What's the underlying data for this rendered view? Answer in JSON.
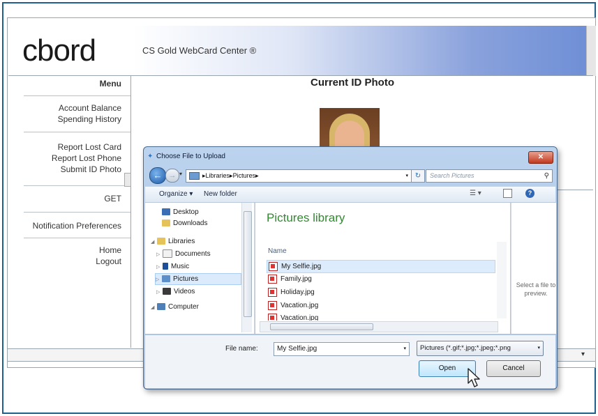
{
  "site": {
    "logo": "cbord",
    "banner_title": "CS Gold WebCard Center ®",
    "menu_title": "Menu",
    "menu_groups": [
      [
        "Account Balance",
        "Spending History"
      ],
      [
        "Report Lost Card",
        "Report Lost Phone",
        "Submit ID Photo"
      ],
      [
        "GET"
      ],
      [
        "Notification Preferences"
      ],
      [
        "Home",
        "Logout"
      ]
    ],
    "photo_title": "Current ID Photo"
  },
  "dialog": {
    "title": "Choose File to Upload",
    "close_symbol": "✕",
    "breadcrumb": [
      "Libraries",
      "Pictures"
    ],
    "search_placeholder": "Search Pictures",
    "toolbar": {
      "organize": "Organize ▾",
      "new_folder": "New folder"
    },
    "nav_items": [
      {
        "label": "Desktop",
        "icon": "desktop-icon"
      },
      {
        "label": "Downloads",
        "icon": "downloads-folder-icon"
      },
      {
        "label": "Libraries",
        "icon": "libraries-icon"
      },
      {
        "label": "Documents",
        "icon": "documents-icon"
      },
      {
        "label": "Music",
        "icon": "music-icon"
      },
      {
        "label": "Pictures",
        "icon": "pictures-icon",
        "selected": true
      },
      {
        "label": "Videos",
        "icon": "videos-icon"
      },
      {
        "label": "Computer",
        "icon": "computer-icon"
      }
    ],
    "library_title": "Pictures library",
    "column_name": "Name",
    "files": [
      {
        "name": "My Selfie.jpg",
        "selected": true
      },
      {
        "name": "Family.jpg"
      },
      {
        "name": "Holiday.jpg"
      },
      {
        "name": "Vacation.jpg"
      },
      {
        "name": "Vacation.jpg"
      }
    ],
    "preview_text": "Select a file to preview.",
    "filename_label": "File name:",
    "filename_value": "My Selfie.jpg",
    "filetype_value": "Pictures (*.gif;*.jpg;*.jpeg;*.png",
    "open_label": "Open",
    "cancel_label": "Cancel"
  },
  "colors": {
    "frame": "#1f5f8b",
    "banner_end": "#6f8fd6",
    "library_title": "#2e8b2e"
  }
}
